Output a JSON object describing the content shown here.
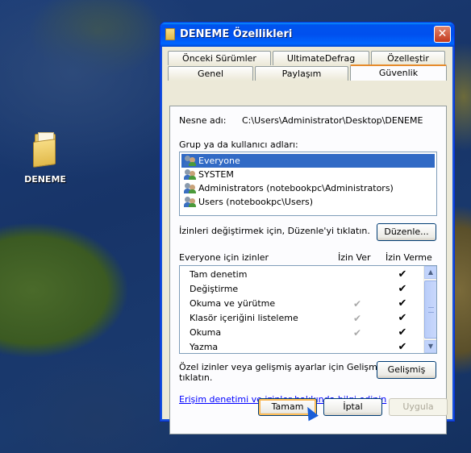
{
  "desktop": {
    "icon_label": "DENEME"
  },
  "window": {
    "title": "DENEME Özellikleri",
    "close_glyph": "✕"
  },
  "tabs": {
    "row1": [
      "Önceki Sürümler",
      "UltimateDefrag",
      "Özelleştir"
    ],
    "row2": [
      "Genel",
      "Paylaşım",
      "Güvenlik"
    ],
    "active": "Güvenlik"
  },
  "security": {
    "object_label": "Nesne adı:",
    "object_path": "C:\\Users\\Administrator\\Desktop\\DENEME",
    "groups_label": "Grup ya da kullanıcı adları:",
    "users": [
      {
        "name": "Everyone",
        "selected": true
      },
      {
        "name": "SYSTEM",
        "selected": false
      },
      {
        "name": "Administrators (notebookpc\\Administrators)",
        "selected": false
      },
      {
        "name": "Users (notebookpc\\Users)",
        "selected": false
      }
    ],
    "edit_hint": "İzinleri değiştirmek için, Düzenle'yi tıklatın.",
    "edit_button": "Düzenle...",
    "perm_header": "Everyone için izinler",
    "allow_header": "İzin Ver",
    "deny_header": "İzin Verme",
    "permissions": [
      {
        "name": "Tam denetim",
        "allow": "",
        "deny": "✔"
      },
      {
        "name": "Değiştirme",
        "allow": "",
        "deny": "✔"
      },
      {
        "name": "Okuma ve yürütme",
        "allow": "✔",
        "deny": "✔"
      },
      {
        "name": "Klasör içeriğini listeleme",
        "allow": "✔",
        "deny": "✔"
      },
      {
        "name": "Okuma",
        "allow": "✔",
        "deny": "✔"
      },
      {
        "name": "Yazma",
        "allow": "",
        "deny": "✔"
      }
    ],
    "advanced_hint_line1": "Özel izinler veya gelişmiş ayarlar için Gelişmiş'i",
    "advanced_hint_line2": "tıklatın.",
    "advanced_button": "Gelişmiş",
    "help_link": "Erişim denetimi ve izinler hakkında bilgi edinin"
  },
  "footer": {
    "ok": "Tamam",
    "cancel": "İptal",
    "apply": "Uygula"
  },
  "colors": {
    "titlebar": "#0053ee",
    "selection": "#316ac5",
    "active_tab_accent": "#e68b2c",
    "link": "#0000ff"
  }
}
